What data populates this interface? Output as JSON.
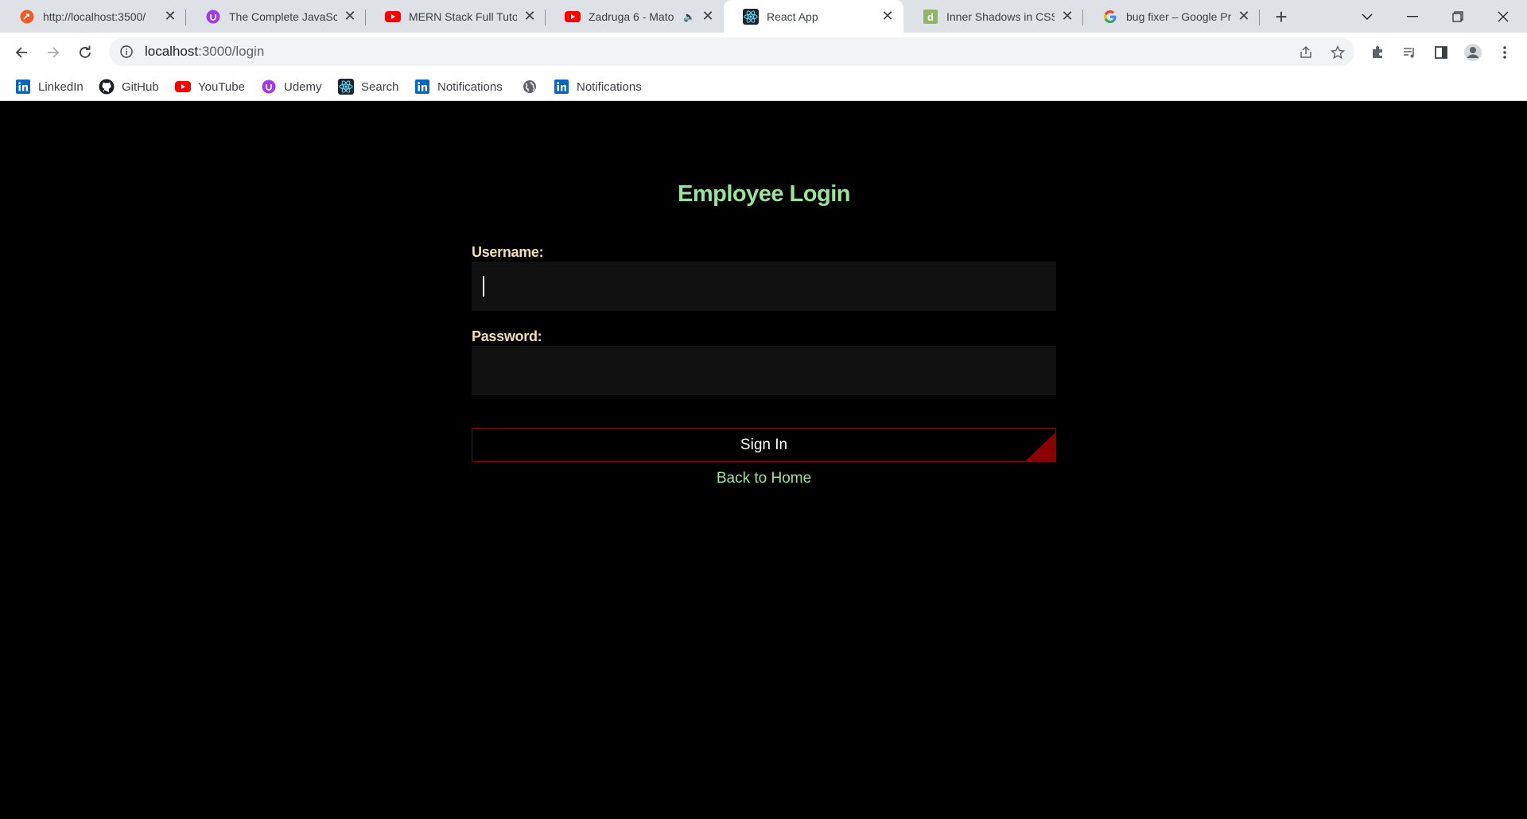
{
  "browser": {
    "tabs": [
      {
        "title": "http://localhost:3500/",
        "icon": "postman-icon"
      },
      {
        "title": "The Complete JavaScript",
        "icon": "udemy-icon"
      },
      {
        "title": "MERN Stack Full Tutorial",
        "icon": "youtube-icon"
      },
      {
        "title": "Zadruga 6 - Mato",
        "icon": "youtube-icon",
        "audio": "🔈"
      },
      {
        "title": "React App",
        "icon": "react-icon",
        "active": true
      },
      {
        "title": "Inner Shadows in CSS",
        "icon": "d-icon"
      },
      {
        "title": "bug fixer – Google Pr",
        "icon": "google-icon"
      }
    ],
    "new_tab": "+",
    "window_controls": {
      "list": "⌄",
      "minimize": "—",
      "restore": "❐",
      "close": "✕"
    },
    "url": {
      "host": "localhost",
      "path": ":3000/login"
    },
    "bookmarks": [
      {
        "label": "LinkedIn",
        "icon": "linkedin-icon"
      },
      {
        "label": "GitHub",
        "icon": "github-icon"
      },
      {
        "label": "YouTube",
        "icon": "youtube-icon"
      },
      {
        "label": "Udemy",
        "icon": "udemy-icon"
      },
      {
        "label": "Search",
        "icon": "react-icon"
      },
      {
        "label": "Notifications",
        "icon": "linkedin-icon"
      },
      {
        "label": "",
        "icon": "globe-icon"
      },
      {
        "label": "Notifications",
        "icon": "linkedin-icon"
      }
    ]
  },
  "login": {
    "title": "Employee Login",
    "username_label": "Username:",
    "username_value": "",
    "password_label": "Password:",
    "password_value": "",
    "submit_label": "Sign In",
    "back_label": "Back to Home"
  },
  "colors": {
    "title": "#9be39b",
    "label": "#f5deb3",
    "input_bg": "#111111",
    "button_border": "#8b0000",
    "page_bg": "#000000"
  }
}
